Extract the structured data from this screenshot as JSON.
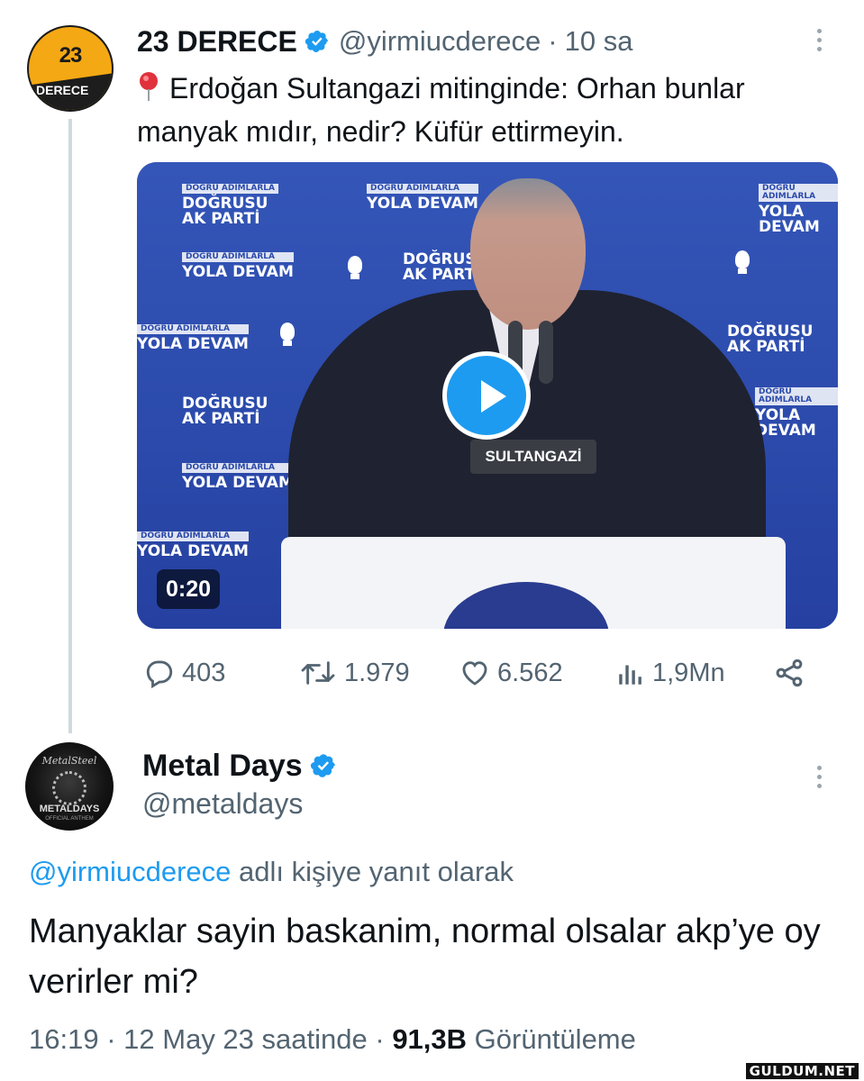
{
  "tweet1": {
    "avatar_text_top": "23",
    "avatar_text_bottom": "DERECE",
    "display_name": "23 DERECE",
    "handle": "@yirmiucderece",
    "separator": "·",
    "time": "10 sa",
    "text": "Erdoğan Sultangazi mitinginde: Orhan bunlar manyak mıdır, nedir? Küfür ettirmeyin.",
    "media": {
      "duration": "0:20",
      "mic_label": "SULTANGAZİ",
      "banner_small_1": "DOĞRU ADIMLARLA",
      "banner_big_1": "YOLA DEVAM",
      "banner_big_2a": "DOĞRUSU",
      "banner_big_2b": "AK PARTİ"
    },
    "stats": {
      "replies": "403",
      "retweets": "1.979",
      "likes": "6.562",
      "views": "1,9Mn"
    }
  },
  "tweet2": {
    "avatar_text_top": "MetalSteel",
    "avatar_text_bottom": "METALDAYS",
    "avatar_text_sub": "OFFICIAL ANTHEM",
    "display_name": "Metal Days",
    "handle": "@metaldays",
    "reply_mention": "@yirmiucderece",
    "reply_suffix": " adlı kişiye yanıt olarak",
    "text": "Manyaklar sayin baskanim, normal olsalar akp’ye oy verirler mi?",
    "time": "16:19",
    "date": "12 May 23 saatinde",
    "separator": "·",
    "views_count": "91,3B",
    "views_label": "Görüntüleme"
  },
  "watermark": "GULDUM.NET",
  "colors": {
    "accent": "#1d9bf0",
    "text": "#0f1419",
    "secondary": "#536471",
    "avatar1": "#f4a814"
  },
  "icons": [
    "verified-badge-icon",
    "more-options-icon",
    "pin-icon",
    "play-icon",
    "reply-icon",
    "retweet-icon",
    "like-icon",
    "views-icon",
    "share-icon"
  ]
}
